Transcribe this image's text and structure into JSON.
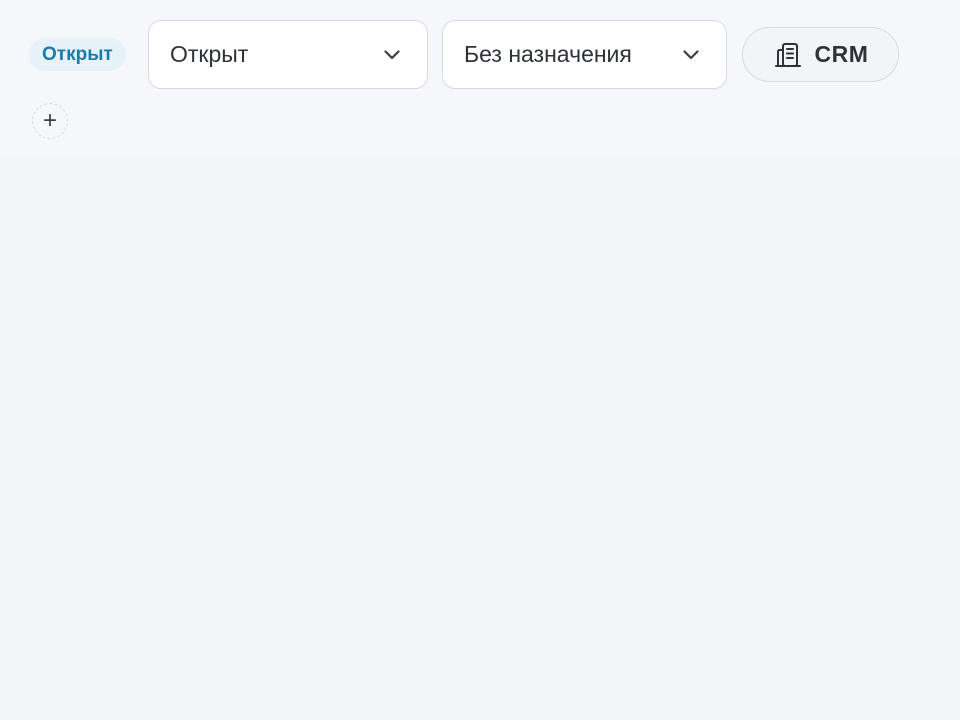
{
  "status_badge": {
    "label": "Открыт",
    "color": "#1c7aa8",
    "background": "#e6f2f8"
  },
  "status_select": {
    "value": "Открыт",
    "icon": "chevron-down-icon"
  },
  "assignee_select": {
    "value": "Без назначения",
    "icon": "chevron-down-icon"
  },
  "crm_button": {
    "label": "CRM",
    "icon": "building-icon"
  },
  "add_button": {
    "label": "+",
    "icon": "plus-icon"
  }
}
